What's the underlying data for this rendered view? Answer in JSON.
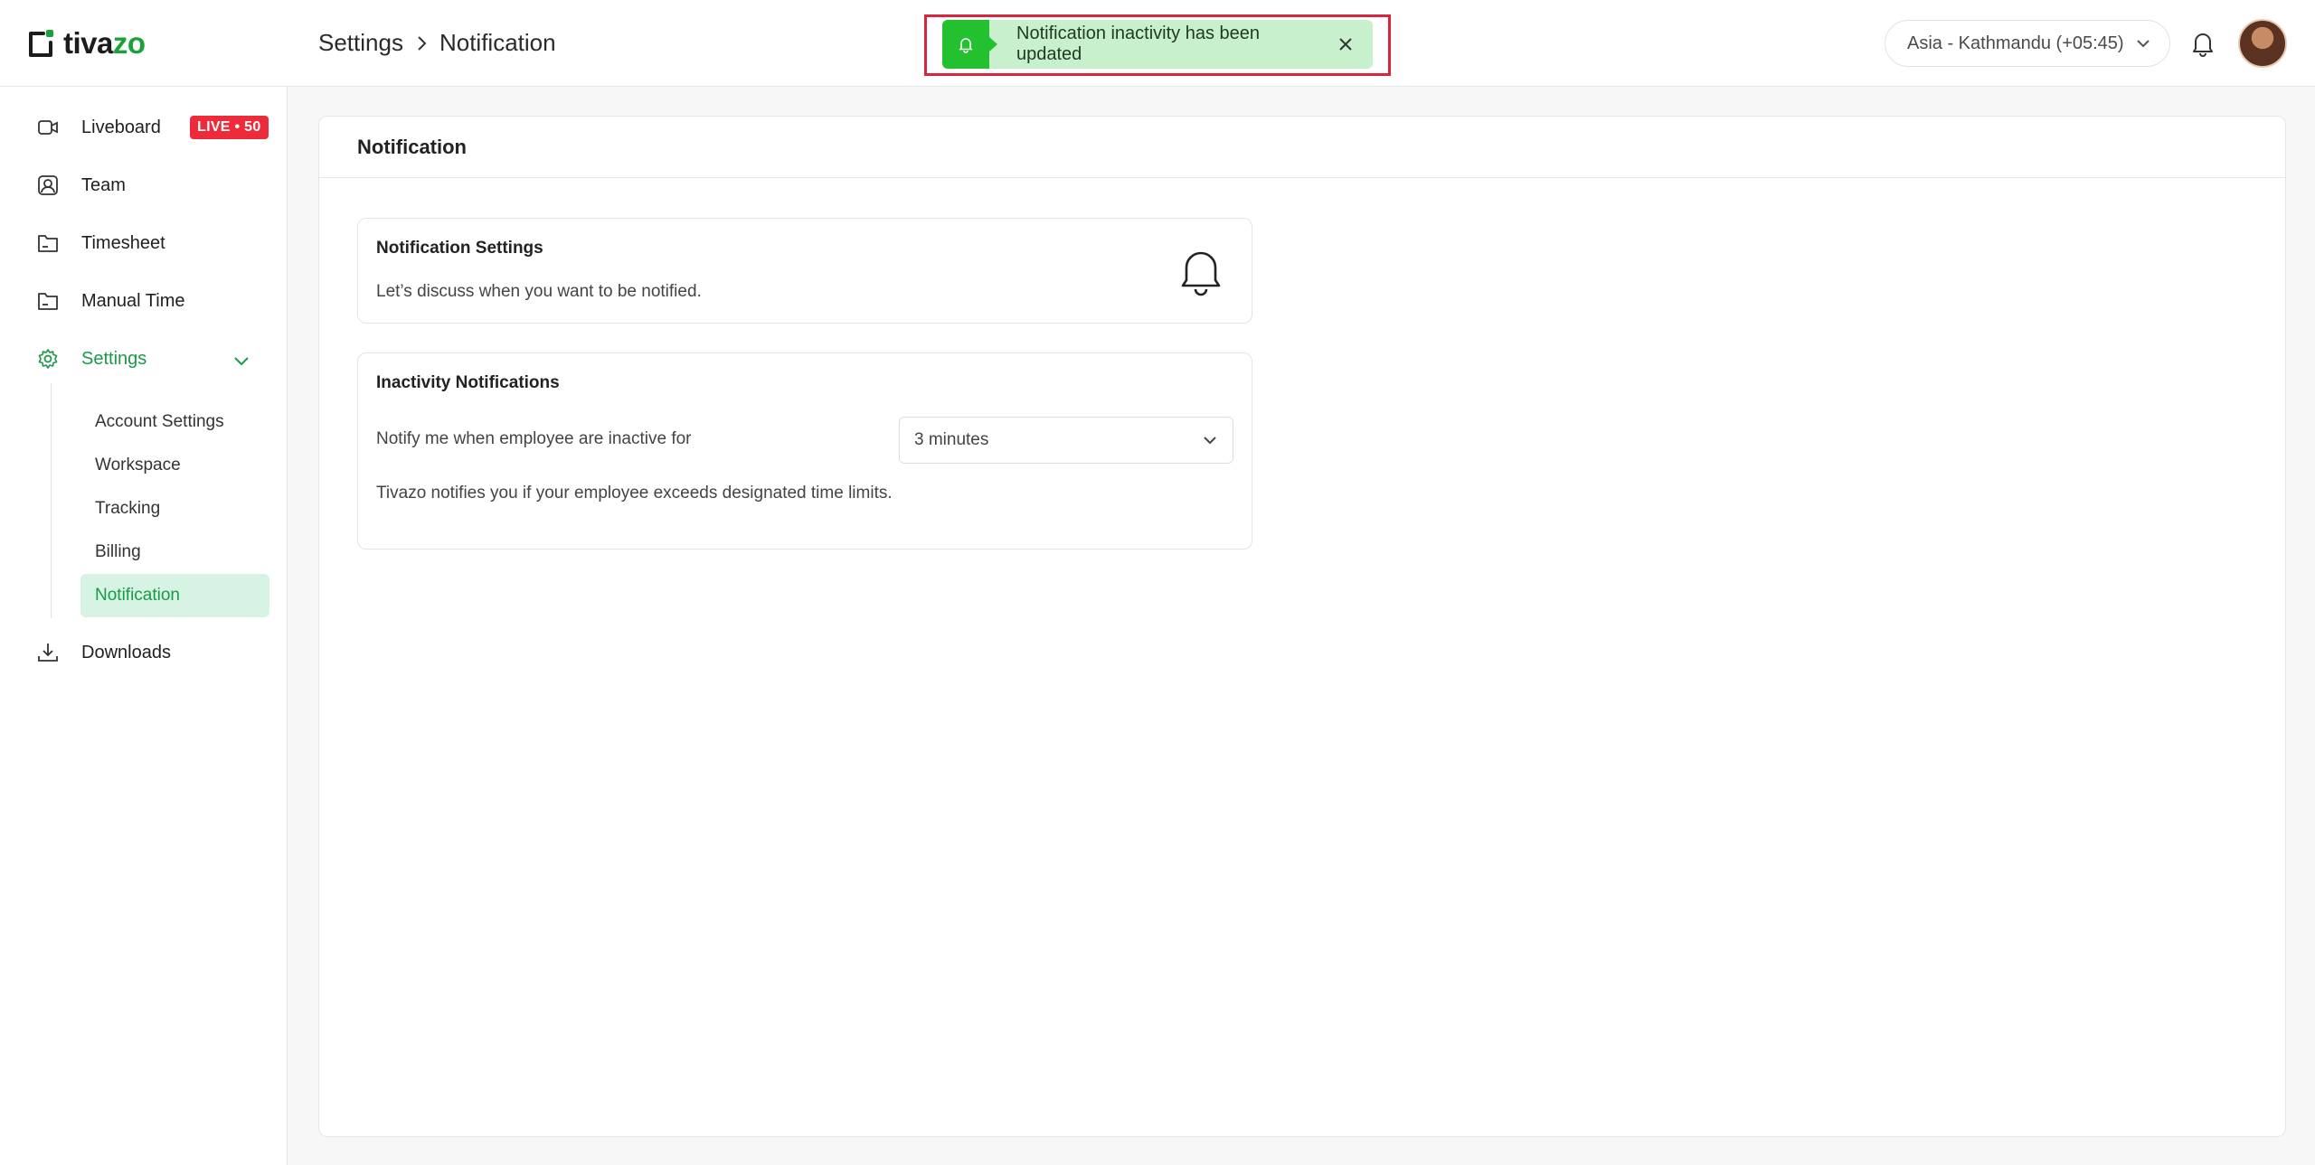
{
  "app": {
    "logo_prefix": "tiva",
    "logo_suffix": "zo",
    "brand_color": "#1aa23a"
  },
  "header": {
    "breadcrumb": [
      "Settings",
      "Notification"
    ],
    "timezone": "Asia - Kathmandu (+05:45)"
  },
  "toast": {
    "message": "Notification inactivity has been updated",
    "icon": "bell-icon",
    "color": "#23c02f"
  },
  "sidebar": {
    "items": [
      {
        "label": "Liveboard",
        "icon": "video-icon"
      },
      {
        "label": "Team",
        "icon": "user-icon"
      },
      {
        "label": "Timesheet",
        "icon": "folder-icon"
      },
      {
        "label": "Manual Time",
        "icon": "folder-icon"
      },
      {
        "label": "Settings",
        "icon": "gear-icon"
      },
      {
        "label": "Downloads",
        "icon": "download-icon"
      }
    ],
    "live_badge": "LIVE • 50",
    "settings_sub": [
      {
        "label": "Account Settings"
      },
      {
        "label": "Workspace"
      },
      {
        "label": "Tracking"
      },
      {
        "label": "Billing"
      },
      {
        "label": "Notification"
      }
    ],
    "active_color": "#1a9a47"
  },
  "main": {
    "title": "Notification",
    "notification_settings": {
      "title": "Notification Settings",
      "description": "Let’s discuss when you want to be notified."
    },
    "inactivity": {
      "title": "Inactivity Notifications",
      "label": "Notify me when employee are inactive for",
      "selected": "3 minutes",
      "note": "Tivazo notifies you if your employee exceeds designated time limits."
    }
  }
}
